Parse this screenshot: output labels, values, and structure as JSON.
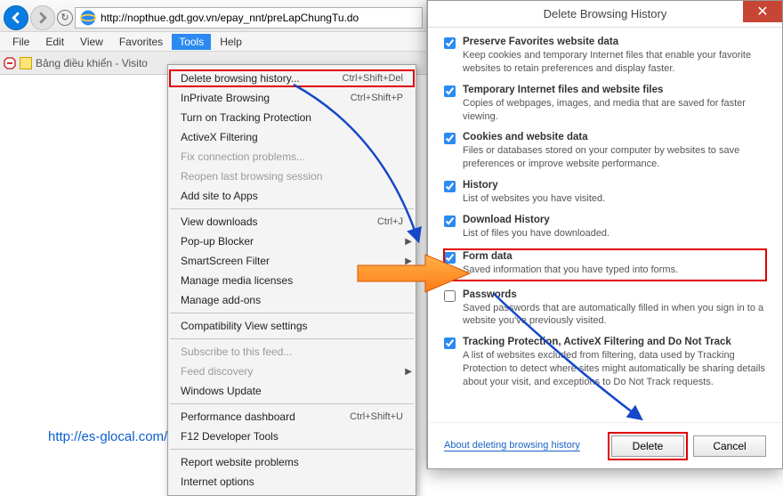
{
  "browser": {
    "url": "http://nopthue.gdt.gov.vn/epay_nnt/preLapChungTu.do",
    "menu": {
      "file": "File",
      "edit": "Edit",
      "view": "View",
      "favorites": "Favorites",
      "tools": "Tools",
      "help": "Help"
    },
    "tab_label": "Bảng điều khiển - Visito"
  },
  "tools_menu": [
    {
      "label": "Delete browsing history...",
      "shortcut": "Ctrl+Shift+Del",
      "hl": true
    },
    {
      "label": "InPrivate Browsing",
      "shortcut": "Ctrl+Shift+P"
    },
    {
      "label": "Turn on Tracking Protection"
    },
    {
      "label": "ActiveX Filtering"
    },
    {
      "label": "Fix connection problems...",
      "disabled": true
    },
    {
      "label": "Reopen last browsing session",
      "disabled": true
    },
    {
      "label": "Add site to Apps"
    },
    {
      "sep": true
    },
    {
      "label": "View downloads",
      "shortcut": "Ctrl+J"
    },
    {
      "label": "Pop-up Blocker",
      "sub": true
    },
    {
      "label": "SmartScreen Filter",
      "sub": true
    },
    {
      "label": "Manage media licenses"
    },
    {
      "label": "Manage add-ons"
    },
    {
      "sep": true
    },
    {
      "label": "Compatibility View settings"
    },
    {
      "sep": true
    },
    {
      "label": "Subscribe to this feed...",
      "disabled": true
    },
    {
      "label": "Feed discovery",
      "disabled": true,
      "sub": true
    },
    {
      "label": "Windows Update"
    },
    {
      "sep": true
    },
    {
      "label": "Performance dashboard",
      "shortcut": "Ctrl+Shift+U"
    },
    {
      "label": "F12 Developer Tools"
    },
    {
      "sep": true
    },
    {
      "label": "Report website problems"
    },
    {
      "label": "Internet options"
    }
  ],
  "dialog": {
    "title": "Delete Browsing History",
    "options": [
      {
        "checked": true,
        "title": "Preserve Favorites website data",
        "desc": "Keep cookies and temporary Internet files that enable your favorite websites to retain preferences and display faster."
      },
      {
        "checked": true,
        "title": "Temporary Internet files and website files",
        "desc": "Copies of webpages, images, and media that are saved for faster viewing."
      },
      {
        "checked": true,
        "title": "Cookies and website data",
        "desc": "Files or databases stored on your computer by websites to save preferences or improve website performance."
      },
      {
        "checked": true,
        "title": "History",
        "desc": "List of websites you have visited."
      },
      {
        "checked": true,
        "title": "Download History",
        "desc": "List of files you have downloaded."
      },
      {
        "checked": true,
        "title": "Form data",
        "desc": "Saved information that you have typed into forms.",
        "hl": true
      },
      {
        "checked": false,
        "title": "Passwords",
        "desc": "Saved passwords that are automatically filled in when you sign in to a website you've previously visited."
      },
      {
        "checked": true,
        "title": "Tracking Protection, ActiveX Filtering and Do Not Track",
        "desc": "A list of websites excluded from filtering, data used by Tracking Protection to detect where sites might automatically be sharing details about your visit, and exceptions to Do Not Track requests."
      }
    ],
    "link": "About deleting browsing history",
    "delete": "Delete",
    "cancel": "Cancel"
  },
  "watermark_link": "http://es-glocal.com/"
}
